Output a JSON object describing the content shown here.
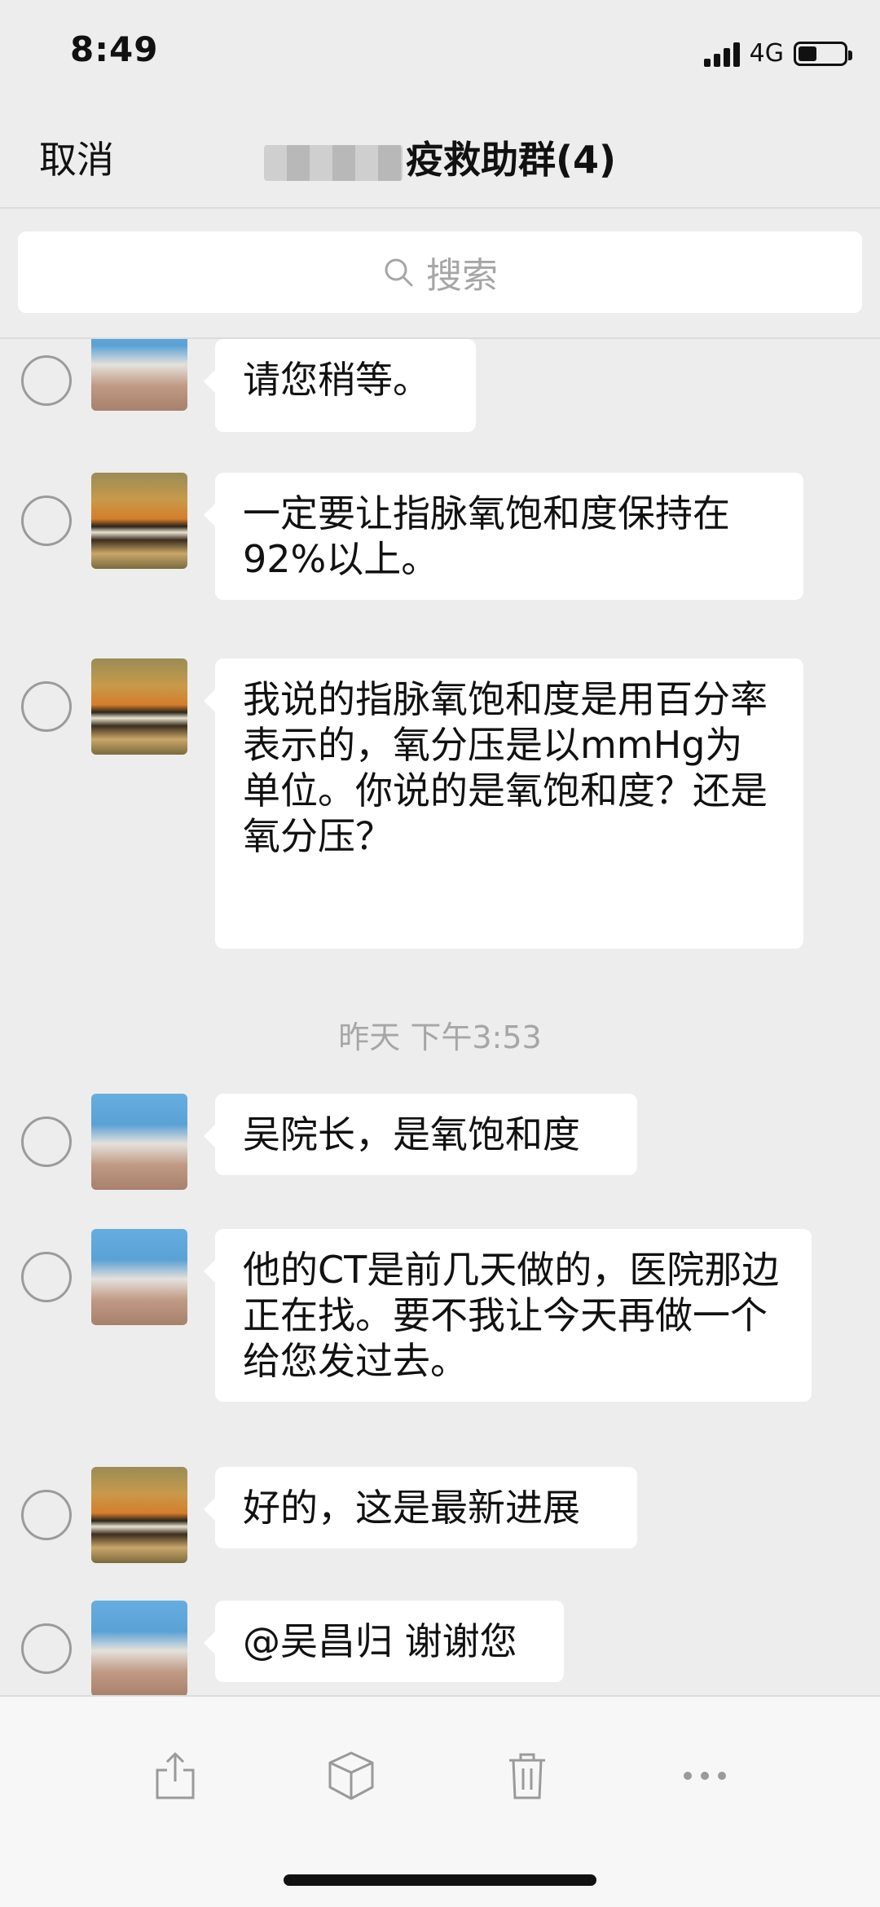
{
  "status_bar": {
    "time": "8:49",
    "network": "4G",
    "battery_level": 0.4
  },
  "nav": {
    "cancel_label": "取消",
    "title": "疫救助群(4)"
  },
  "search": {
    "placeholder": "搜索",
    "icon": "search-icon"
  },
  "messages": [
    {
      "avatar": "blurred-avatar",
      "text": "请您稍等。"
    },
    {
      "avatar": "tiger-avatar",
      "text": "一定要让指脉氧饱和度保持在92%以上。"
    },
    {
      "avatar": "tiger-avatar",
      "text": "我说的指脉氧饱和度是用百分率表示的，氧分压是以mmHg为单位。你说的是氧饱和度？还是氧分压？"
    },
    {
      "avatar": "blurred-avatar",
      "text": "吴院长，是氧饱和度"
    },
    {
      "avatar": "blurred-avatar",
      "text": "他的CT是前几天做的，医院那边正在找。要不我让今天再做一个给您发过去。"
    },
    {
      "avatar": "tiger-avatar",
      "text": "好的，这是最新进展"
    },
    {
      "avatar": "blurred-avatar",
      "text": "@吴昌归 谢谢您"
    }
  ],
  "timestamp": "昨天 下午3:53",
  "toolbar": {
    "icons": [
      "share-icon",
      "box-icon",
      "trash-icon",
      "more-icon"
    ]
  },
  "colors": {
    "background": "#ededed",
    "bubble": "#ffffff",
    "text": "#111111",
    "muted": "#a6a6a6",
    "toolbar": "#f7f7f7"
  }
}
